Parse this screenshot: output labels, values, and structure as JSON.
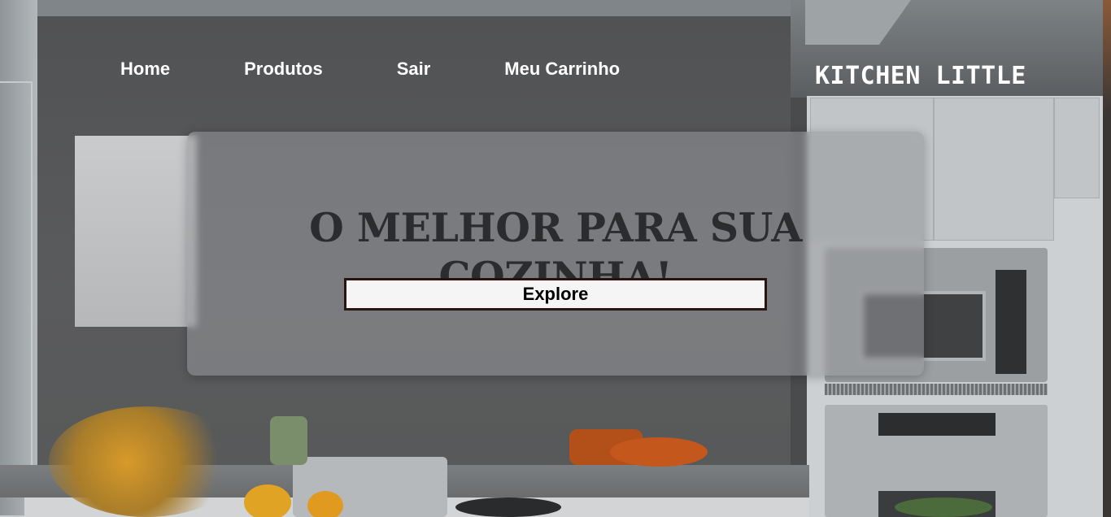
{
  "nav": {
    "links": [
      {
        "label": "Home"
      },
      {
        "label": "Produtos"
      },
      {
        "label": "Sair"
      },
      {
        "label": "Meu Carrinho"
      }
    ]
  },
  "brand": "KITCHEN LITTLE",
  "hero": {
    "headline": "O MELHOR PARA SUA COZINHA!",
    "button_label": "Explore"
  },
  "colors": {
    "nav_text": "#ffffff",
    "headline_text": "#2b2c2e",
    "button_border": "#2a1410",
    "button_bg": "#f5f5f5"
  }
}
